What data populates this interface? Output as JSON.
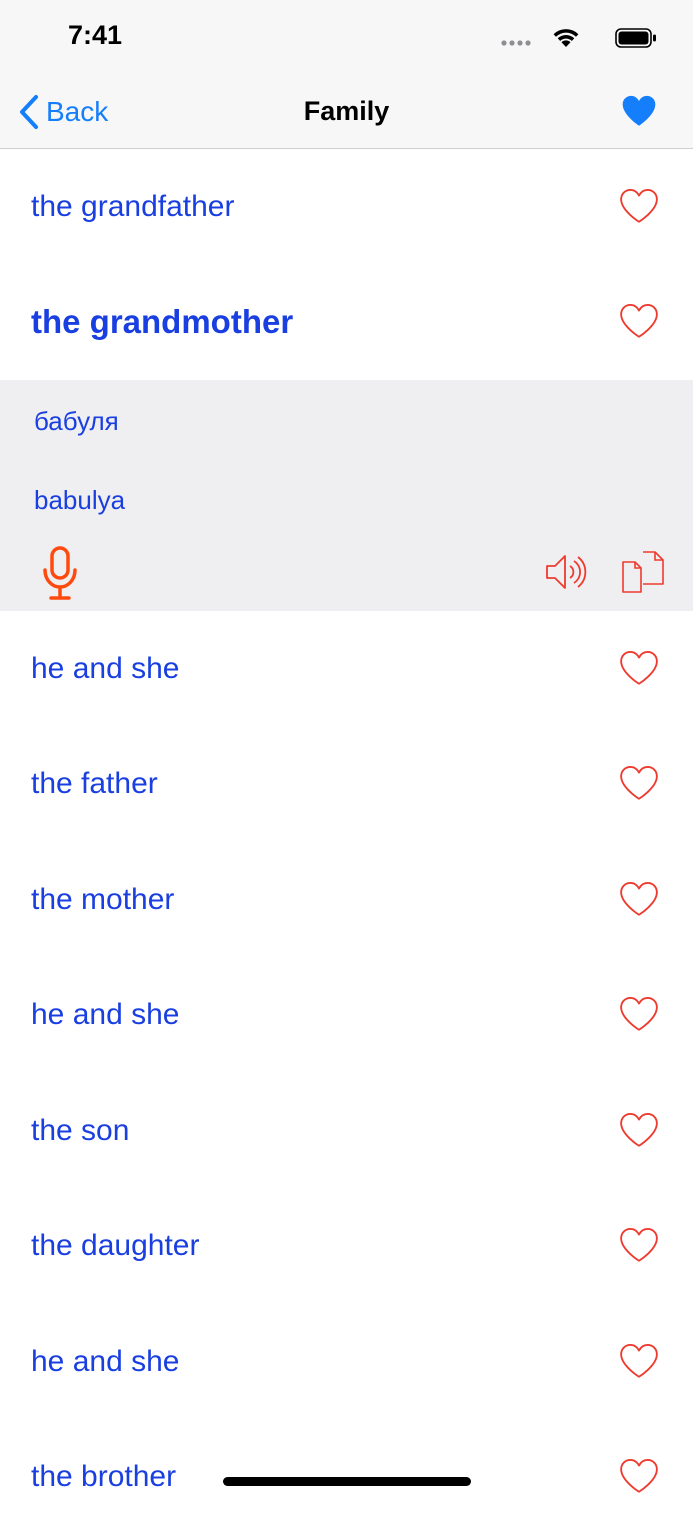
{
  "status": {
    "time": "7:41"
  },
  "nav": {
    "back_label": "Back",
    "title": "Family"
  },
  "colors": {
    "accent": "#147efb",
    "label": "#1a3fe0",
    "heart": "#ee3b2f",
    "mic": "#ff4a0f"
  },
  "words": [
    {
      "label": "the grandfather"
    },
    {
      "label": "the grandmother",
      "expanded": true,
      "translation": "бабуля",
      "transliteration": "babulya"
    },
    {
      "label": "he and she"
    },
    {
      "label": "the father"
    },
    {
      "label": "the mother"
    },
    {
      "label": "he and she"
    },
    {
      "label": "the son"
    },
    {
      "label": "the daughter"
    },
    {
      "label": "he and she"
    },
    {
      "label": "the brother"
    }
  ],
  "icons": {
    "heart": "heart-outline-icon",
    "favorite": "heart-filled-icon",
    "mic": "microphone-icon",
    "speaker": "speaker-icon",
    "copy": "copy-icon"
  }
}
